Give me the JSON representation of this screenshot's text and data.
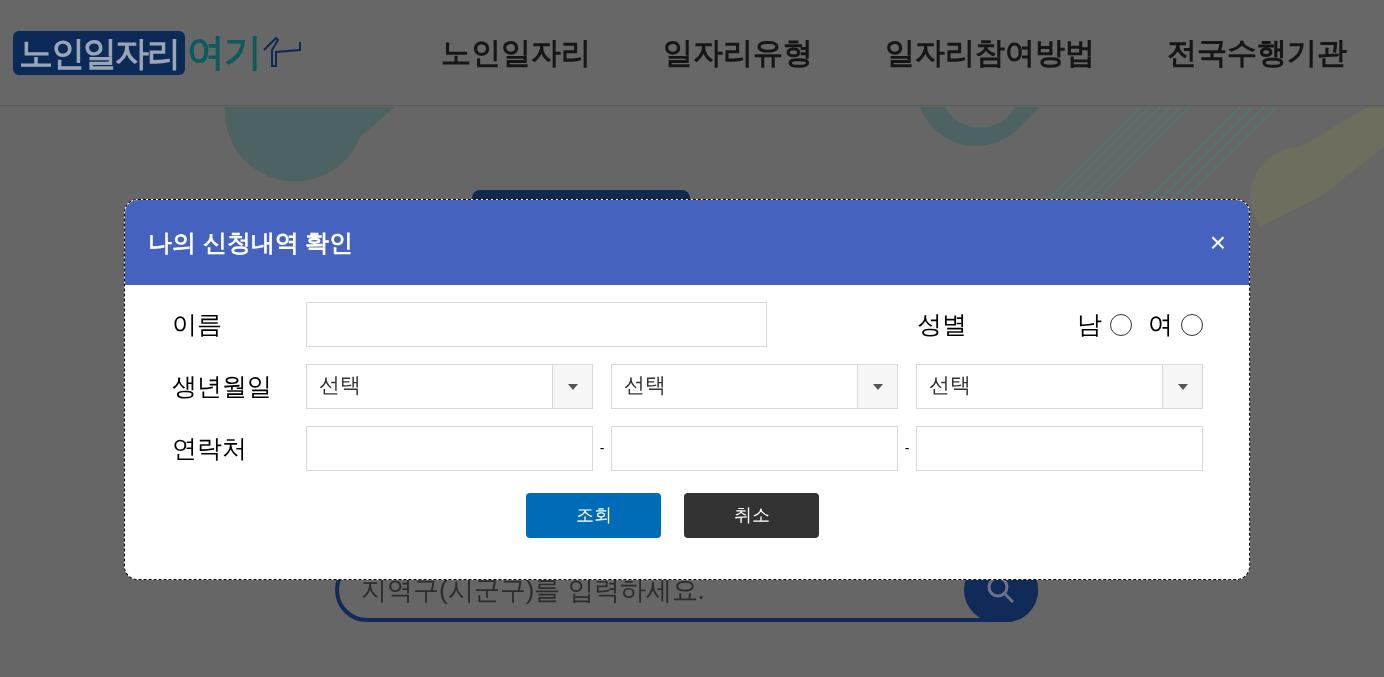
{
  "logo": {
    "main": "노인일자리",
    "accent": "여기"
  },
  "nav": [
    {
      "label": "노인일자리"
    },
    {
      "label": "일자리유형"
    },
    {
      "label": "일자리참여방법"
    },
    {
      "label": "전국수행기관"
    }
  ],
  "search": {
    "placeholder": "지역구(시군구)를 입력하세요."
  },
  "dialog": {
    "title": "나의 신청내역 확인",
    "close": "×",
    "name_label": "이름",
    "gender_label": "성별",
    "genders": [
      {
        "label": "남",
        "selected": false
      },
      {
        "label": "여",
        "selected": false
      }
    ],
    "birth_label": "생년월일",
    "birth_selects": [
      {
        "value": "선택"
      },
      {
        "value": "선택"
      },
      {
        "value": "선택"
      }
    ],
    "phone_label": "연락처",
    "phone_separator": "-",
    "buttons": [
      {
        "label": "조회",
        "kind": "primary"
      },
      {
        "label": "취소",
        "kind": "secondary"
      }
    ]
  }
}
